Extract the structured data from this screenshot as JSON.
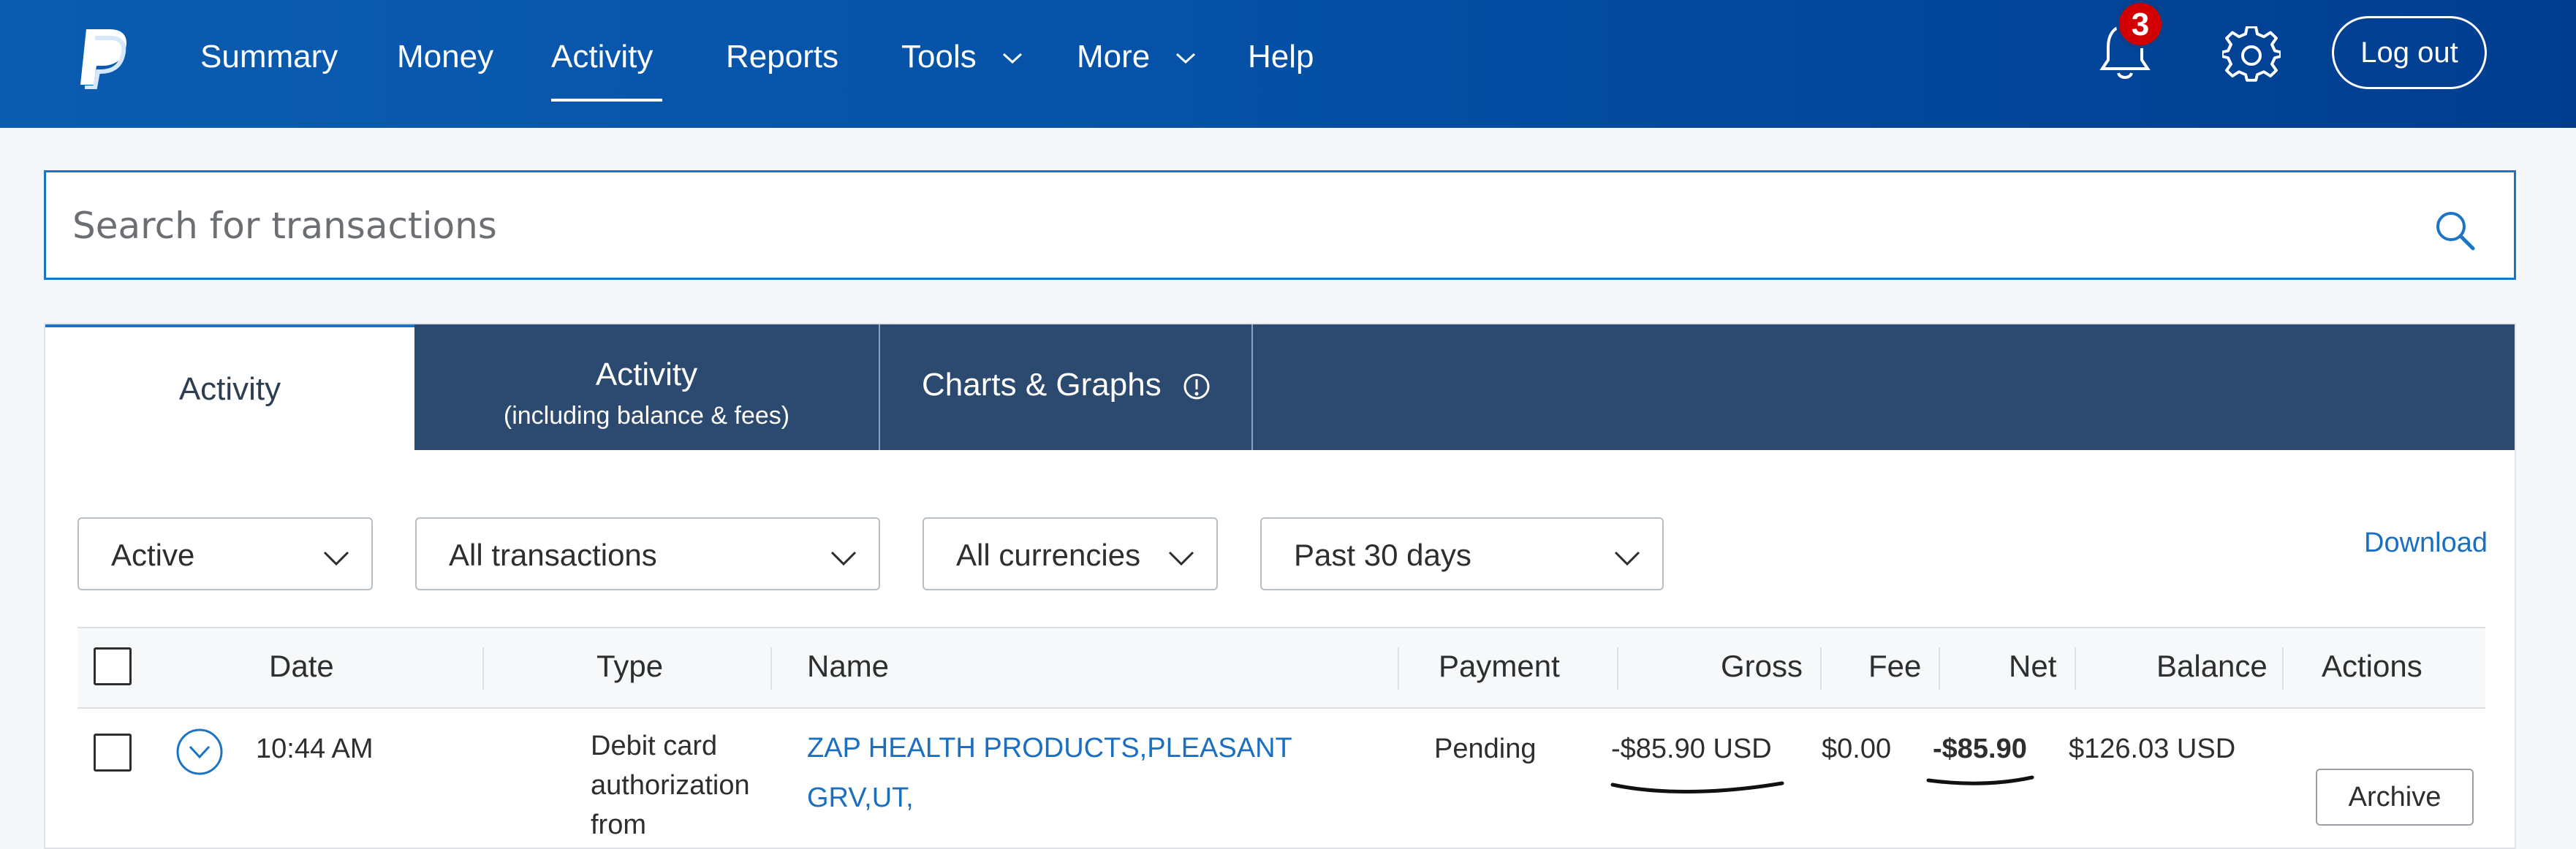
{
  "nav": {
    "logo": "paypal-logo-icon",
    "items": [
      {
        "label": "Summary",
        "active": false
      },
      {
        "label": "Money",
        "active": false
      },
      {
        "label": "Activity",
        "active": true
      },
      {
        "label": "Reports",
        "active": false
      },
      {
        "label": "Tools",
        "active": false,
        "dropdown": true
      },
      {
        "label": "More",
        "active": false,
        "dropdown": true
      },
      {
        "label": "Help",
        "active": false
      }
    ],
    "notification_count": "3",
    "logout_label": "Log out"
  },
  "search": {
    "placeholder": "Search for transactions",
    "icon": "search-icon"
  },
  "tabs": [
    {
      "label": "Activity",
      "active": true
    },
    {
      "label": "Activity",
      "sublabel": "(including balance & fees)",
      "active": false
    },
    {
      "label": "Charts & Graphs",
      "active": false,
      "icon": "info-icon"
    }
  ],
  "filters": {
    "status": "Active",
    "transaction_type": "All transactions",
    "currency": "All currencies",
    "date_range": "Past 30 days",
    "download_label": "Download"
  },
  "table": {
    "columns": [
      "Date",
      "Type",
      "Name",
      "Payment",
      "Gross",
      "Fee",
      "Net",
      "Balance",
      "Actions"
    ],
    "rows": [
      {
        "date": "10:44 AM",
        "type_lines": [
          "Debit card",
          "authorization",
          "from"
        ],
        "name_lines": [
          "ZAP HEALTH PRODUCTS,PLEASANT",
          "GRV,UT,"
        ],
        "payment": "Pending",
        "gross": "-$85.90 USD",
        "fee": "$0.00",
        "net": "-$85.90",
        "balance": "$126.03 USD",
        "action_label": "Archive"
      }
    ]
  },
  "colors": {
    "nav_bg": "#0552a8",
    "tab_bar_bg": "#2c4a70",
    "link": "#1b6fc0",
    "badge": "#d20000"
  }
}
